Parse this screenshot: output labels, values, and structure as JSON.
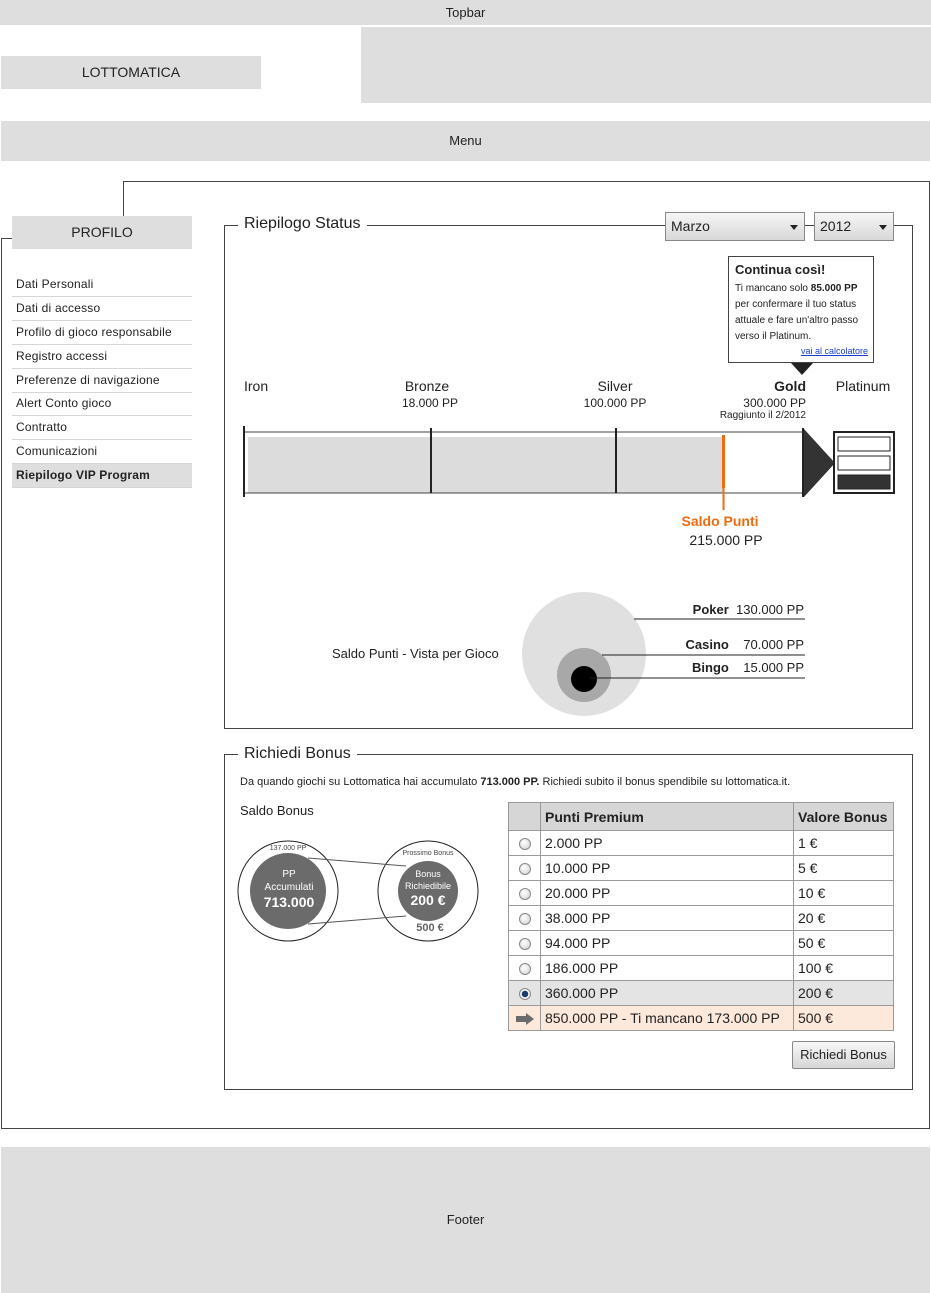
{
  "topbar": {
    "label": "Topbar"
  },
  "logo": {
    "label": "LOTTOMATICA"
  },
  "menu": {
    "label": "Menu"
  },
  "sidebar": {
    "tab": "PROFILO",
    "items": [
      {
        "label": "Dati Personali",
        "active": false
      },
      {
        "label": "Dati di accesso",
        "active": false
      },
      {
        "label": "Profilo di gioco responsabile",
        "active": false
      },
      {
        "label": "Registro accessi",
        "active": false
      },
      {
        "label": "Preferenze di navigazione",
        "active": false
      },
      {
        "label": "Alert Conto gioco",
        "active": false
      },
      {
        "label": "Contratto",
        "active": false
      },
      {
        "label": "Comunicazioni",
        "active": false
      },
      {
        "label": "Riepilogo VIP Program",
        "active": true
      }
    ]
  },
  "status": {
    "legend": "Riepilogo Status",
    "month_select": "Marzo",
    "year_select": "2012",
    "tooltip": {
      "title": "Continua così!",
      "body_prefix": "Ti mancano solo ",
      "body_bold": "85.000 PP",
      "body_suffix": " per confermare il tuo status attuale e fare un'altro passo verso il Platinum.",
      "link": "vai al calcolatore"
    },
    "levels": [
      {
        "name": "Iron",
        "points": ""
      },
      {
        "name": "Bronze",
        "points": "18.000 PP"
      },
      {
        "name": "Silver",
        "points": "100.000 PP"
      },
      {
        "name": "Gold",
        "points": "300.000 PP",
        "note": "Raggiunto il 2/2012"
      },
      {
        "name": "Platinum",
        "points": ""
      }
    ],
    "progress": {
      "current_points": 215000,
      "max_points": 300000
    },
    "saldo": {
      "label": "Saldo Punti",
      "value": "215.000 PP"
    },
    "accent_color": "#ee6c0f"
  },
  "per_gioco": {
    "label": "Saldo Punti - Vista per Gioco",
    "games": [
      {
        "name": "Poker",
        "value": "130.000 PP",
        "points": 130000
      },
      {
        "name": "Casino",
        "value": "70.000 PP",
        "points": 70000
      },
      {
        "name": "Bingo",
        "value": "15.000 PP",
        "points": 15000
      }
    ]
  },
  "bonus": {
    "legend": "Richiedi Bonus",
    "intro_prefix": "Da quando giochi su Lottomatica hai accumulato ",
    "intro_bold": "713.000 PP.",
    "intro_suffix": " Richiedi subito il bonus spendibile su lottomatica.it.",
    "saldo_label": "Saldo Bonus",
    "circle_left": {
      "top_label": "137.000 PP",
      "line1": "PP",
      "line2": "Accumulati",
      "value": "713.000"
    },
    "circle_right": {
      "top_label": "Prossimo Bonus",
      "line1": "Bonus",
      "line2": "Richiedibile",
      "value": "200 €",
      "bottom_label": "500 €"
    },
    "table": {
      "headers": [
        "Punti Premium",
        "Valore Bonus"
      ],
      "rows": [
        {
          "pp": "2.000 PP",
          "bonus": "1 €"
        },
        {
          "pp": "10.000 PP",
          "bonus": "5 €"
        },
        {
          "pp": "20.000 PP",
          "bonus": "10 €"
        },
        {
          "pp": "38.000 PP",
          "bonus": "20 €"
        },
        {
          "pp": "94.000 PP",
          "bonus": "50 €"
        },
        {
          "pp": "186.000 PP",
          "bonus": "100 €"
        },
        {
          "pp": "360.000 PP",
          "bonus": "200 €"
        },
        {
          "pp": "850.000 PP - Ti mancano 173.000 PP",
          "bonus": "500 €"
        }
      ]
    },
    "button": "Richiedi Bonus"
  },
  "footer": {
    "label": "Footer"
  }
}
